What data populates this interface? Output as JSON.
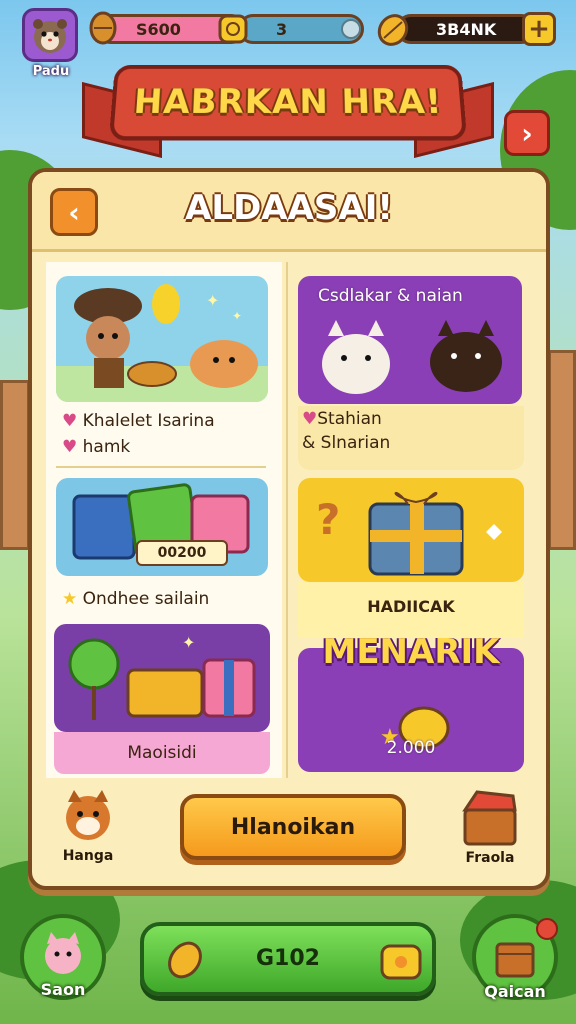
{
  "topbar": {
    "profile_label": "Padu",
    "resource1_value": "S600",
    "resource1_level": "3",
    "resource2_value": "3B4NK"
  },
  "banner": {
    "title": "HABRKAN HRA!"
  },
  "panel": {
    "title": "ALDAASAI!",
    "cards": {
      "left1_line1": "Khalelet Isarina",
      "left1_line2": "hamk",
      "right1_header": "Csdlakar & naian",
      "right1_line1": "Stahian",
      "right1_line2": "& Slnarian",
      "left2_price": "00200",
      "left2_label": "Ondhee sailain",
      "right2_label": "HADIICAK",
      "left3_label": "Maoisidi",
      "right3_title": "MENARIK",
      "right3_value": "2.000"
    },
    "cta_label": "Hlanoikan",
    "side_left_label": "Hanga",
    "side_right_label": "Fraola"
  },
  "bottombar": {
    "left_label": "Saon",
    "center_label": "G102",
    "right_label": "Qaican"
  },
  "colors": {
    "panel_bg": "#fbeebc",
    "accent_orange": "#f59a1c",
    "accent_purple": "#8a3fb6",
    "accent_yellow": "#f7c82a",
    "accent_green": "#5fc240",
    "banner_red": "#d94a36"
  },
  "icons": [
    "hamster-icon",
    "coin-icon",
    "peanut-icon",
    "plus-icon",
    "chevron-right-icon",
    "chevron-left-icon",
    "gift-icon",
    "dog-icon",
    "sack-icon"
  ]
}
